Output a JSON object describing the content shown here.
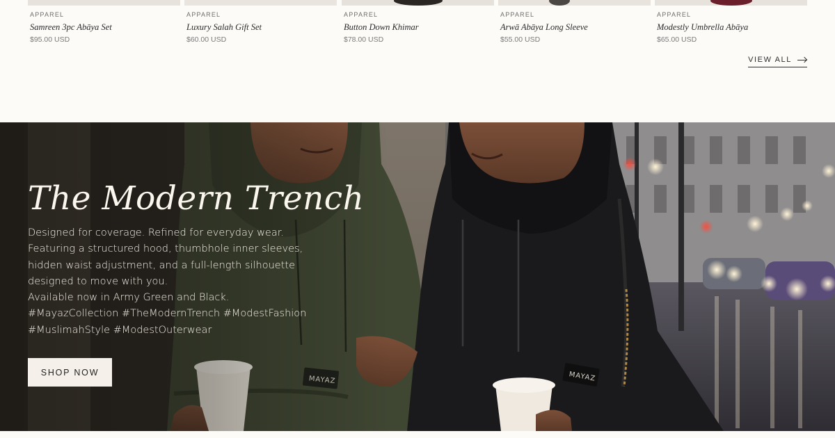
{
  "products": [
    {
      "category": "APPAREL",
      "name": "Samreen 3pc Abāya Set",
      "price": "$95.00 USD",
      "thumb_color": "#e7e2db"
    },
    {
      "category": "APPAREL",
      "name": "Luxury Salah Gift Set",
      "price": "$60.00 USD",
      "thumb_color": "#e9e5de"
    },
    {
      "category": "APPAREL",
      "name": "Button Down Khimar",
      "price": "$78.00 USD",
      "thumb_color": "#e6e1da"
    },
    {
      "category": "APPAREL",
      "name": "Arwā Abāya Long Sleeve",
      "price": "$55.00 USD",
      "thumb_color": "#e8e4dd"
    },
    {
      "category": "APPAREL",
      "name": "Modestly Umbrella Abāya",
      "price": "$65.00 USD",
      "thumb_color": "#e7e2db"
    }
  ],
  "view_all": {
    "label": "VIEW ALL",
    "icon": "arrow-right-icon"
  },
  "hero": {
    "title": "The Modern Trench",
    "body_lines": [
      "Designed for coverage. Refined for everyday wear.",
      "Featuring a structured hood, thumbhole inner sleeves,",
      "hidden waist adjustment, and a full-length silhouette",
      "designed to move with you.",
      "Available now in Army Green and Black.",
      "#MayazCollection #TheModernTrench #ModestFashion",
      "#MuslimahStyle #ModestOuterwear"
    ],
    "button_label": "SHOP NOW",
    "badge_text": "MAYAZ"
  },
  "colors": {
    "background": "#fcfbf8",
    "army_green": "#3f4632",
    "black_coat": "#1a1a1c",
    "button_bg": "#f5f1ea"
  }
}
